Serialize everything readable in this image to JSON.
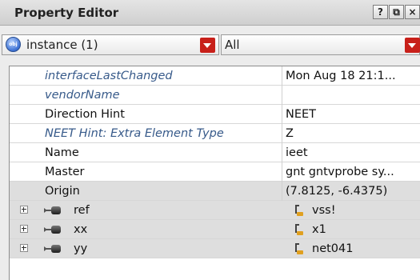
{
  "window": {
    "title": "Property Editor",
    "buttons": [
      "?",
      "⧉",
      "×"
    ]
  },
  "selector": {
    "object_label": "instance (1)",
    "filter_label": "All"
  },
  "properties": [
    {
      "name": "interfaceLastChanged",
      "value": "Mon Aug 18 21:1...",
      "italic": true
    },
    {
      "name": "vendorName",
      "value": "",
      "italic": true
    },
    {
      "name": "Direction Hint",
      "value": "NEET",
      "italic": false
    },
    {
      "name": "NEET Hint: Extra Element Type",
      "value": "Z",
      "italic": true
    },
    {
      "name": "Name",
      "value": "ieet",
      "italic": false
    },
    {
      "name": "Master",
      "value": "gnt gntvprobe sy...",
      "italic": false
    },
    {
      "name": "Origin",
      "value": "(7.8125, -6.4375)",
      "italic": false
    }
  ],
  "terminals": [
    {
      "name": "ref",
      "net": "vss!"
    },
    {
      "name": "xx",
      "net": "x1"
    },
    {
      "name": "yy",
      "net": "net041"
    }
  ]
}
